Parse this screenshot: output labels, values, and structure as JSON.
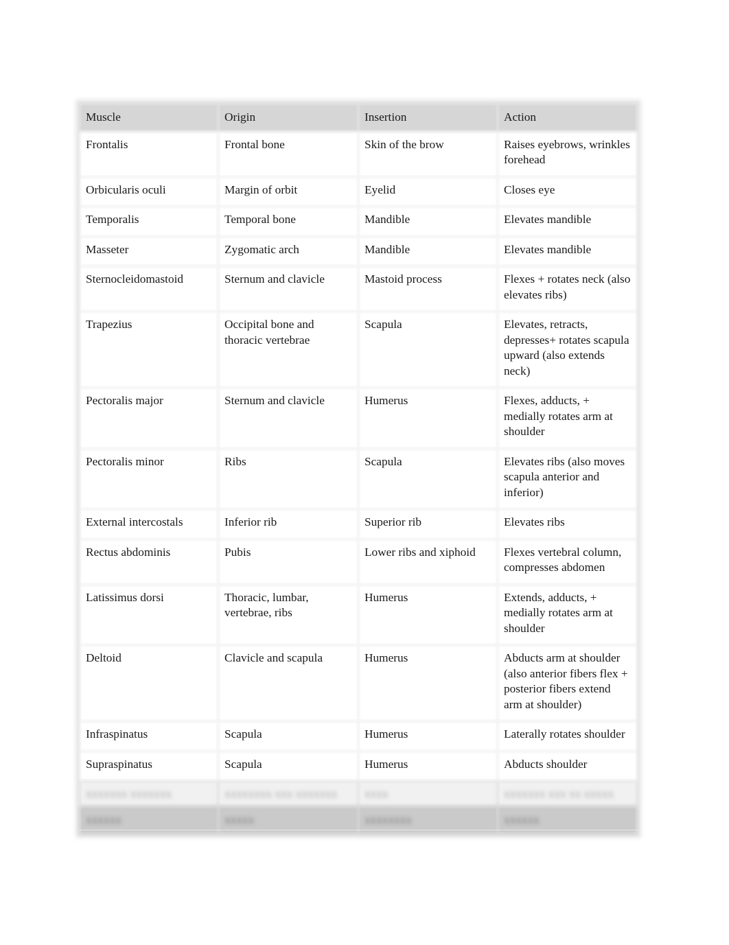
{
  "table": {
    "headers": [
      "Muscle",
      "Origin",
      "Insertion",
      "Action"
    ],
    "rows": [
      [
        "Frontalis",
        "Frontal bone",
        "Skin of the brow",
        "Raises eyebrows, wrinkles forehead"
      ],
      [
        "Orbicularis oculi",
        "Margin of orbit",
        "Eyelid",
        "Closes eye"
      ],
      [
        "Temporalis",
        "Temporal bone",
        "Mandible",
        "Elevates mandible"
      ],
      [
        "Masseter",
        "Zygomatic arch",
        "Mandible",
        "Elevates mandible"
      ],
      [
        "Sternocleidomastoid",
        "Sternum and clavicle",
        "Mastoid process",
        "Flexes + rotates neck (also elevates ribs)"
      ],
      [
        "Trapezius",
        "Occipital bone and thoracic vertebrae",
        "Scapula",
        "Elevates, retracts, depresses+ rotates scapula upward (also extends neck)"
      ],
      [
        "Pectoralis major",
        "Sternum and clavicle",
        "Humerus",
        "Flexes, adducts, + medially rotates arm at shoulder"
      ],
      [
        "Pectoralis minor",
        "Ribs",
        "Scapula",
        "Elevates ribs (also moves scapula anterior and inferior)"
      ],
      [
        "External intercostals",
        "Inferior rib",
        "Superior rib",
        "Elevates ribs"
      ],
      [
        "Rectus abdominis",
        "Pubis",
        "Lower ribs and xiphoid",
        "Flexes vertebral column, compresses abdomen"
      ],
      [
        "Latissimus dorsi",
        "Thoracic, lumbar, vertebrae, ribs",
        "Humerus",
        "Extends, adducts, + medially rotates arm at shoulder"
      ],
      [
        "Deltoid",
        "Clavicle and scapula",
        "Humerus",
        "Abducts arm at shoulder (also anterior fibers flex + posterior fibers extend arm at shoulder)"
      ],
      [
        "Infraspinatus",
        "Scapula",
        "Humerus",
        "Laterally rotates shoulder"
      ],
      [
        "Supraspinatus",
        "Scapula",
        "Humerus",
        "Abducts shoulder"
      ]
    ],
    "blurred_row": [
      "xxxxxxx xxxxxxx",
      "xxxxxxxx xxx xxxxxxx",
      "xxxx",
      "xxxxxxx xxx xx xxxxx"
    ],
    "blurred_header": [
      "xxxxxx",
      "xxxxx",
      "xxxxxxxx",
      "xxxxxx"
    ]
  }
}
